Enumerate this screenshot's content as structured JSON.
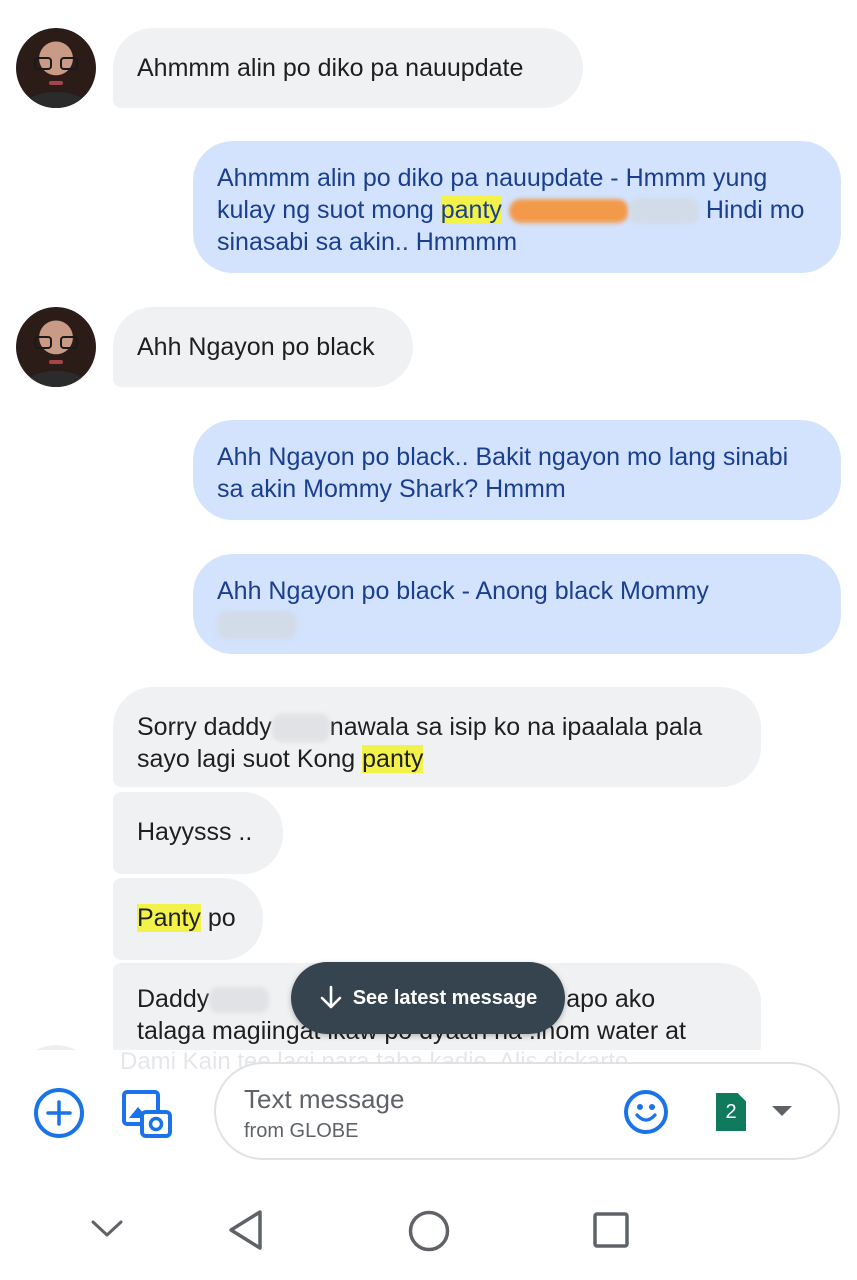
{
  "messages": [
    {
      "text": "Ahmmm alin po diko pa nauupdate"
    },
    {
      "part1": "Ahmmm alin po diko pa nauupdate - Hmmm yung kulay ng suot mong ",
      "highlight": "panty",
      "part2": " Hindi mo sinasabi sa akin.. Hmmmm"
    },
    {
      "text": "Ahh Ngayon po black"
    },
    {
      "text": "Ahh Ngayon po black.. Bakit ngayon mo lang sinabi sa akin Mommy Shark? Hmmm"
    },
    {
      "text": "Ahh Ngayon po black - Anong black Mommy"
    },
    {
      "part1": "Sorry daddy",
      "part2": "nawala sa isip ko  na ipaalala pala sayo lagi suot Kong ",
      "highlight": "panty"
    },
    {
      "text": "Hayysss .."
    },
    {
      "highlight": "Panty",
      "part2": " po"
    },
    {
      "part1": "Daddy",
      "part2": "apo ako",
      "part3": "talaga magiingat ikaw po dyaan na .inom water at"
    }
  ],
  "see_latest": {
    "label": "See latest message",
    "icon": "arrow-down-icon"
  },
  "faded_text": "Dami Kain tee lagi para taba kadie. Alis dickarto",
  "composer": {
    "placeholder": "Text message",
    "carrier": "from GLOBE",
    "sim_number": "2",
    "icons": [
      "add-icon",
      "gallery-icon",
      "emoji-icon",
      "sim-card-icon",
      "dropdown-icon"
    ]
  },
  "colors": {
    "incoming_bubble": "#f0f1f3",
    "outgoing_bubble": "#d3e3fd",
    "outgoing_text": "#1a3f8f",
    "accent": "#1a73e8",
    "highlight": "#f2f24a",
    "snackbar": "#35444e",
    "sim_badge": "#0f7a5c"
  },
  "navbar": {
    "icons": [
      "back-chevron-icon",
      "back-triangle-icon",
      "home-circle-icon",
      "recents-square-icon"
    ]
  }
}
